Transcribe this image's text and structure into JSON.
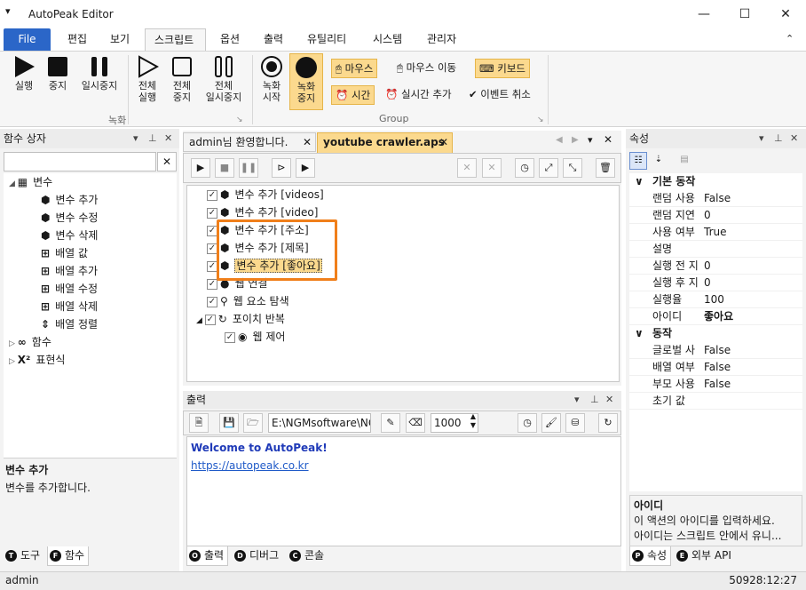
{
  "app": {
    "title": "AutoPeak Editor"
  },
  "window": {
    "minimize": "—",
    "maximize": "☐",
    "close": "✕"
  },
  "tabs": [
    "File",
    "편집",
    "보기",
    "스크립트",
    "옵션",
    "출력",
    "유틸리티",
    "시스템",
    "관리자"
  ],
  "ribbon": {
    "run": "실행",
    "stop": "중지",
    "pause": "일시중지",
    "all_run": [
      "전체",
      "실행"
    ],
    "all_stop": [
      "전체",
      "중지"
    ],
    "all_pause": [
      "전체",
      "일시중지"
    ],
    "record_group": "녹화",
    "rec_start": [
      "녹화",
      "시작"
    ],
    "rec_stop": [
      "녹화",
      "중지"
    ],
    "mouse": "마우스",
    "mouse_move": "마우스 이동",
    "keyboard": "키보드",
    "time": "시간",
    "realtime_add": "실시간 추가",
    "event_cancel": "이벤트 취소",
    "group_label": "Group"
  },
  "left_panel": {
    "title": "함수 상자",
    "search_value": "",
    "tree": [
      {
        "label": "변수",
        "level": 0,
        "icon": "variable-group-icon"
      },
      {
        "label": "변수 추가",
        "level": 1,
        "icon": "cube-add-icon"
      },
      {
        "label": "변수 수정",
        "level": 1,
        "icon": "cube-edit-icon"
      },
      {
        "label": "변수 삭제",
        "level": 1,
        "icon": "cube-delete-icon"
      },
      {
        "label": "배열 값",
        "level": 1,
        "icon": "array-value-icon"
      },
      {
        "label": "배열 추가",
        "level": 1,
        "icon": "array-add-icon"
      },
      {
        "label": "배열 수정",
        "level": 1,
        "icon": "array-edit-icon"
      },
      {
        "label": "배열 삭제",
        "level": 1,
        "icon": "array-delete-icon"
      },
      {
        "label": "배열 정렬",
        "level": 1,
        "icon": "array-sort-icon"
      },
      {
        "label": "함수",
        "level": 0,
        "icon": "function-icon"
      },
      {
        "label": "표현식",
        "level": 0,
        "icon": "expression-icon"
      }
    ],
    "desc_title": "변수 추가",
    "desc_text": "변수를 추가합니다.",
    "bottom_tabs": [
      {
        "badge": "T",
        "label": "도구"
      },
      {
        "badge": "F",
        "label": "함수"
      }
    ]
  },
  "doc_tabs": [
    {
      "label": "admin님 환영합니다.",
      "active": false
    },
    {
      "label": "youtube crawler.aps",
      "active": true
    }
  ],
  "script_tree": [
    {
      "label": "변수 추가 [videos]",
      "indent": 0,
      "icon": "cube-icon"
    },
    {
      "label": "변수 추가 [video]",
      "indent": 0,
      "icon": "cube-icon"
    },
    {
      "label": "변수 추가 [주소]",
      "indent": 0,
      "icon": "cube-icon"
    },
    {
      "label": "변수 추가 [제목]",
      "indent": 0,
      "icon": "cube-icon"
    },
    {
      "label": "변수 추가 [좋아요]",
      "indent": 0,
      "icon": "cube-icon",
      "selected": true
    },
    {
      "label": "웹 연결",
      "indent": 0,
      "icon": "web-connect-icon"
    },
    {
      "label": "웹 요소 탐색",
      "indent": 0,
      "icon": "search-element-icon"
    },
    {
      "label": "포이치 반복",
      "indent": 0,
      "icon": "loop-icon",
      "expanded": true
    },
    {
      "label": "웹 제어",
      "indent": 1,
      "icon": "web-control-icon"
    }
  ],
  "output_panel": {
    "title": "출력",
    "path_value": "E:\\NGMsoftware\\NG",
    "count_value": "1000",
    "lines": [
      {
        "text": "Welcome to AutoPeak!",
        "type": "bold"
      },
      {
        "text": "https://autopeak.co.kr",
        "type": "link"
      }
    ],
    "bottom_tabs": [
      {
        "badge": "O",
        "label": "출력"
      },
      {
        "badge": "D",
        "label": "디버그"
      },
      {
        "badge": "C",
        "label": "콘솔"
      }
    ]
  },
  "props_panel": {
    "title": "속성",
    "sections": [
      {
        "title": "기본 동작",
        "rows": [
          {
            "k": "랜덤 사용",
            "v": "False"
          },
          {
            "k": "랜덤 지연",
            "v": "0"
          },
          {
            "k": "사용 여부",
            "v": "True"
          },
          {
            "k": "설명",
            "v": ""
          },
          {
            "k": "실행 전 지",
            "v": "0"
          },
          {
            "k": "실행 후 지",
            "v": "0"
          },
          {
            "k": "실행율",
            "v": "100"
          },
          {
            "k": "아이디",
            "v": "좋아요",
            "bold": true
          }
        ]
      },
      {
        "title": "동작",
        "rows": [
          {
            "k": "글로벌 사",
            "v": "False"
          },
          {
            "k": "배열 여부",
            "v": "False"
          },
          {
            "k": "부모 사용",
            "v": "False"
          },
          {
            "k": "초기 값",
            "v": ""
          }
        ]
      }
    ],
    "desc_title": "아이디",
    "desc_lines": [
      "이 액션의 아이디를 입력하세요.",
      "아이디는 스크립트 안에서 유니..."
    ],
    "bottom_tabs": [
      {
        "badge": "P",
        "label": "속성"
      },
      {
        "badge": "E",
        "label": "외부 API"
      }
    ]
  },
  "status": {
    "left": "admin",
    "right": "50928:12:27"
  },
  "colors": {
    "accent": "#2b66c8",
    "highlight": "#f07f1a",
    "selection": "#fbd98e"
  }
}
